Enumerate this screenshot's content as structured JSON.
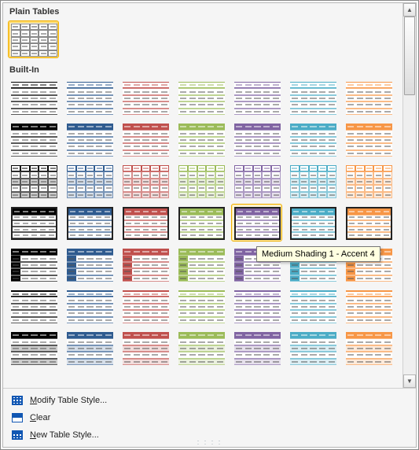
{
  "sections": {
    "plain_header": "Plain Tables",
    "builtin_header": "Built-In"
  },
  "plain_styles": [
    {
      "name": "Table Grid"
    }
  ],
  "accent_colors": [
    "#000000",
    "#2f5b8f",
    "#c0504d",
    "#9bbb59",
    "#8064a2",
    "#4bacc6",
    "#f79646"
  ],
  "builtin_rows": [
    {
      "family": "Light Shading",
      "has_header_fill": false,
      "rows_only": true,
      "alt": false
    },
    {
      "family": "Light List",
      "has_header_fill": true,
      "rows_only": true,
      "alt": false
    },
    {
      "family": "Light Grid",
      "has_header_fill": false,
      "rows_only": false,
      "alt": true
    },
    {
      "family": "Medium Shading 1",
      "has_header_fill": true,
      "rows_only": true,
      "alt": false,
      "thick_outer": true
    },
    {
      "family": "Medium Shading 2",
      "has_header_fill": true,
      "rows_only": true,
      "alt": false,
      "first_col": true
    },
    {
      "family": "Medium List 1",
      "has_header_fill": false,
      "rows_only": true,
      "alt": false,
      "topline": true
    },
    {
      "family": "Medium List 2",
      "has_header_fill": true,
      "rows_only": true,
      "alt": true
    }
  ],
  "hover": {
    "row": 3,
    "col": 4,
    "tooltip": "Medium Shading 1 - Accent 4"
  },
  "selected": {
    "section": "plain",
    "index": 0
  },
  "menu": {
    "modify": "Modify Table Style...",
    "modify_hotkey_index": 0,
    "clear": "Clear",
    "clear_hotkey_index": 0,
    "new_style": "New Table Style...",
    "new_hotkey_index": 0
  },
  "scrollbar": {
    "thumb_top_pct": 0,
    "thumb_height_pct": 22
  }
}
